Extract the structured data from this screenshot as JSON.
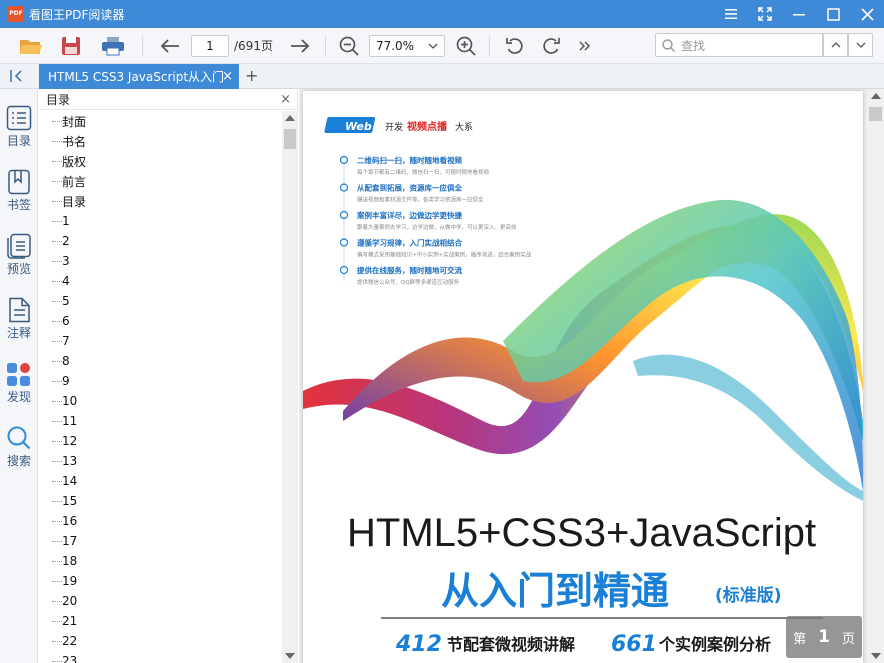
{
  "app": {
    "logo": "PDF",
    "title": "看图王PDF阅读器"
  },
  "toolbar": {
    "page_current": "1",
    "page_total": "/691页",
    "zoom": "77.0%",
    "search_placeholder": "查找"
  },
  "tab": {
    "label": "HTML5 CSS3 JavaScript从入门",
    "close": "×",
    "add": "+"
  },
  "sidebar": {
    "items": [
      {
        "label": "目录",
        "icon": "list-icon"
      },
      {
        "label": "书签",
        "icon": "bookmark-icon"
      },
      {
        "label": "预览",
        "icon": "preview-icon"
      },
      {
        "label": "注释",
        "icon": "annotation-icon"
      },
      {
        "label": "发现",
        "icon": "discover-icon"
      },
      {
        "label": "搜索",
        "icon": "search-icon"
      }
    ]
  },
  "outline": {
    "title": "目录",
    "close": "×",
    "items": [
      "封面",
      "书名",
      "版权",
      "前言",
      "目录",
      "1",
      "2",
      "3",
      "4",
      "5",
      "6",
      "7",
      "8",
      "9",
      "10",
      "11",
      "12",
      "13",
      "14",
      "15",
      "16",
      "17",
      "18",
      "19",
      "20",
      "21",
      "22",
      "23"
    ]
  },
  "cover": {
    "series_badge": "Web",
    "series_pre": "开发",
    "series_mid": "视频点播",
    "series_post": "大系",
    "features": [
      {
        "title": "二维码扫一扫，随时随地看视频",
        "desc": "每个章节都有二维码，微信扫一扫，可随时随地看视频"
      },
      {
        "title": "从配套到拓展，资源库一应俱全",
        "desc": "赠送视频和素材源文件等，各类学习资源库一应俱全"
      },
      {
        "title": "案例丰富详尽，边做边学更快捷",
        "desc": "跟着大量案例去学习，边学边做，从做中学，可以更深入、更高效"
      },
      {
        "title": "遵循学习规律，入门实战相结合",
        "desc": "编写模式采用基础知识+中小实例+实战案例，循序渐进，结合案例实战"
      },
      {
        "title": "提供在线服务，随时随地可交流",
        "desc": "提供微信公众号、QQ群等多渠道互动服务"
      }
    ],
    "title_line1": "HTML5+CSS3+JavaScript",
    "title_line2": "从入门到精通",
    "edition": "(标准版)",
    "stat1_num": "412",
    "stat1_text": "节配套微视频讲解",
    "stat2_num": "661",
    "stat2_text": "个实例案例分析"
  },
  "page_indicator": {
    "prefix": "第",
    "num": "1",
    "suffix": "页"
  },
  "colors": {
    "accent": "#3f8ad6",
    "cover_blue": "#1a7fd6",
    "cover_red": "#e0211c"
  }
}
